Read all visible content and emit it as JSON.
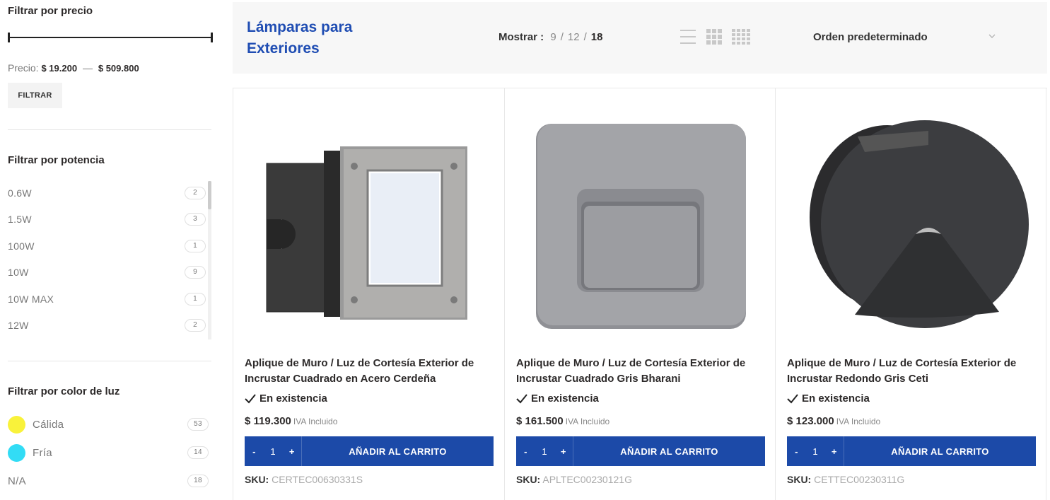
{
  "sidebar": {
    "price_filter": {
      "title": "Filtrar por precio",
      "price_label": "Precio:",
      "min": "$ 19.200",
      "dash": "—",
      "max": "$ 509.800",
      "button": "FILTRAR"
    },
    "power_filter": {
      "title": "Filtrar por potencia",
      "items": [
        {
          "label": "0.6W",
          "count": "2"
        },
        {
          "label": "1.5W",
          "count": "3"
        },
        {
          "label": "100W",
          "count": "1"
        },
        {
          "label": "10W",
          "count": "9"
        },
        {
          "label": "10W MAX",
          "count": "1"
        },
        {
          "label": "12W",
          "count": "2"
        }
      ]
    },
    "color_filter": {
      "title": "Filtrar por color de luz",
      "items": [
        {
          "label": "Cálida",
          "count": "53",
          "swatch": "#f9f23a"
        },
        {
          "label": "Fría",
          "count": "14",
          "swatch": "#32dcf5"
        },
        {
          "label": "N/A",
          "count": "18"
        }
      ]
    }
  },
  "toolbar": {
    "category_title": "Lámparas para Exteriores",
    "show_label": "Mostrar :",
    "show_options": [
      "9",
      "12",
      "18"
    ],
    "show_selected": "18",
    "view_icons": [
      "list-view-icon",
      "grid-3-view-icon",
      "grid-4-view-icon"
    ],
    "order_label": "Orden predeterminado"
  },
  "products": [
    {
      "name": "Aplique de Muro / Luz de Cortesía Exterior de Incrustar Cuadrado en Acero Cerdeña",
      "stock": "En existencia",
      "price": "$ 119.300",
      "tax_note": "IVA Incluido",
      "qty": "1",
      "add_label": "AÑADIR AL CARRITO",
      "sku_label": "SKU:",
      "sku": "CERTEC00630331S",
      "image": "square-steel-wall-light"
    },
    {
      "name": "Aplique de Muro / Luz de Cortesía Exterior de Incrustar Cuadrado Gris Bharani",
      "stock": "En existencia",
      "price": "$ 161.500",
      "tax_note": "IVA Incluido",
      "qty": "1",
      "add_label": "AÑADIR AL CARRITO",
      "sku_label": "SKU:",
      "sku": "APLTEC00230121G",
      "image": "square-grey-wall-light"
    },
    {
      "name": "Aplique de Muro / Luz de Cortesía Exterior de Incrustar Redondo Gris Ceti",
      "stock": "En existencia",
      "price": "$ 123.000",
      "tax_note": "IVA Incluido",
      "qty": "1",
      "add_label": "AÑADIR AL CARRITO",
      "sku_label": "SKU:",
      "sku": "CETTEC00230311G",
      "image": "round-grey-wall-light"
    }
  ],
  "colors": {
    "accent": "#1f4db3",
    "cart_button": "#1c4aa8",
    "toolbar_bg": "#f7f7f7"
  }
}
